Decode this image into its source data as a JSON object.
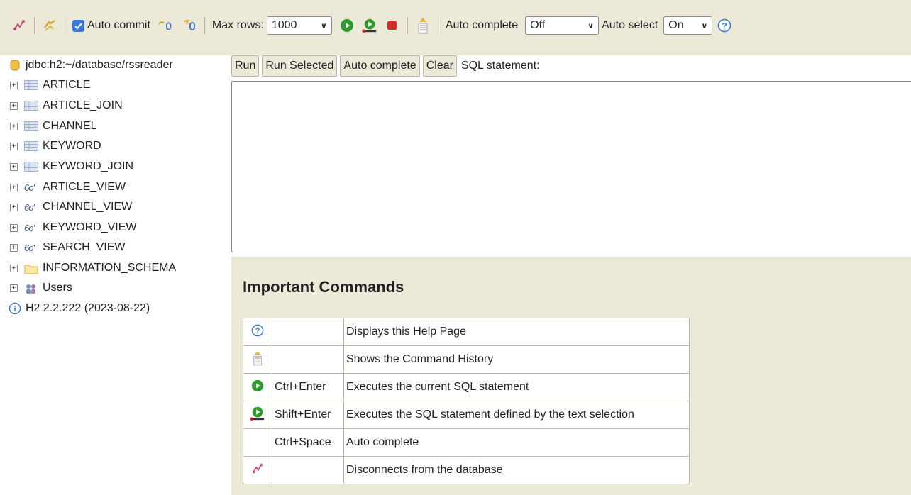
{
  "toolbar": {
    "auto_commit_label": "Auto commit",
    "max_rows_label": "Max rows:",
    "max_rows_value": "1000",
    "auto_complete_label": "Auto complete",
    "auto_complete_value": "Off",
    "auto_select_label": "Auto select",
    "auto_select_value": "On",
    "auto_commit_checked": true
  },
  "tree": {
    "connection": "jdbc:h2:~/database/rssreader",
    "items": [
      {
        "label": "ARTICLE",
        "icon": "table-icon"
      },
      {
        "label": "ARTICLE_JOIN",
        "icon": "table-icon"
      },
      {
        "label": "CHANNEL",
        "icon": "table-icon"
      },
      {
        "label": "KEYWORD",
        "icon": "table-icon"
      },
      {
        "label": "KEYWORD_JOIN",
        "icon": "table-icon"
      },
      {
        "label": "ARTICLE_VIEW",
        "icon": "view-icon"
      },
      {
        "label": "CHANNEL_VIEW",
        "icon": "view-icon"
      },
      {
        "label": "KEYWORD_VIEW",
        "icon": "view-icon"
      },
      {
        "label": "SEARCH_VIEW",
        "icon": "view-icon"
      },
      {
        "label": "INFORMATION_SCHEMA",
        "icon": "folder-icon"
      },
      {
        "label": "Users",
        "icon": "users-icon"
      }
    ],
    "version": "H2 2.2.222 (2023-08-22)"
  },
  "editor": {
    "run_label": "Run",
    "run_selected_label": "Run Selected",
    "auto_complete_label": "Auto complete",
    "clear_label": "Clear",
    "sql_statement_label": "SQL statement:",
    "sql_text": ""
  },
  "help": {
    "title": "Important Commands",
    "rows": [
      {
        "icon": "help-icon",
        "key": "",
        "desc": "Displays this Help Page"
      },
      {
        "icon": "history-icon",
        "key": "",
        "desc": "Shows the Command History"
      },
      {
        "icon": "run-icon",
        "key": "Ctrl+Enter",
        "desc": "Executes the current SQL statement"
      },
      {
        "icon": "run-selected-icon",
        "key": "Shift+Enter",
        "desc": "Executes the SQL statement defined by the text selection"
      },
      {
        "icon": "",
        "key": "Ctrl+Space",
        "desc": "Auto complete"
      },
      {
        "icon": "disconnect-icon",
        "key": "",
        "desc": "Disconnects from the database"
      }
    ]
  },
  "colors": {
    "panel_bg": "#ece9d8",
    "accent_blue": "#3a78d8",
    "run_green": "#2e9a2e",
    "stop_red": "#d62a2a"
  }
}
